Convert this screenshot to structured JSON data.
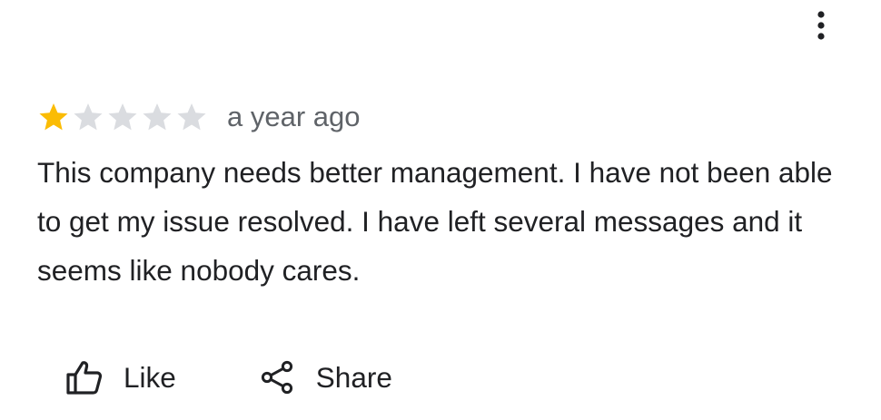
{
  "header": {
    "more_icon": "more-vert-icon"
  },
  "review": {
    "rating": 1,
    "max_rating": 5,
    "star_filled_color": "#fbbc04",
    "star_empty_color": "#dadce0",
    "time_ago": "a year ago",
    "text": "This company needs better management. I have not been able to get my issue resolved. I have left several messages and it seems like nobody cares."
  },
  "actions": {
    "like_label": "Like",
    "like_icon": "thumb-up-icon",
    "share_label": "Share",
    "share_icon": "share-icon"
  }
}
